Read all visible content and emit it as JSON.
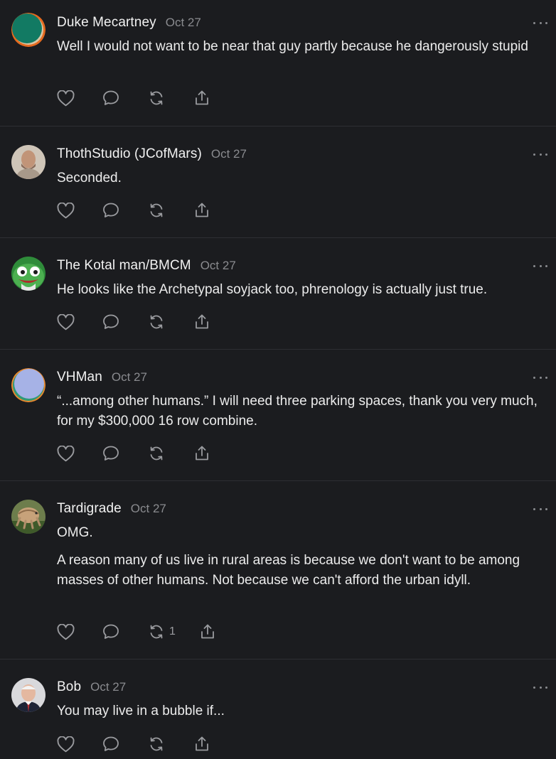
{
  "comments": [
    {
      "author": "Duke Mecartney",
      "date": "Oct 27",
      "paragraphs": [
        "Well I would not want to be near that guy partly because he dangerously stupid"
      ],
      "restack_count": ""
    },
    {
      "author": "ThothStudio (JCofMars)",
      "date": "Oct 27",
      "paragraphs": [
        "Seconded."
      ],
      "restack_count": ""
    },
    {
      "author": "The Kotal man/BMCM",
      "date": "Oct 27",
      "paragraphs": [
        "He looks like the Archetypal soyjack too, phrenology is actually just true."
      ],
      "restack_count": ""
    },
    {
      "author": "VHMan",
      "date": "Oct 27",
      "paragraphs": [
        "“...among other humans.” I will need three parking spaces, thank you very much, for my $300,000 16 row combine."
      ],
      "restack_count": ""
    },
    {
      "author": "Tardigrade",
      "date": "Oct 27",
      "paragraphs": [
        "OMG.",
        "A reason many of us live in rural areas is because we don't want to be among masses of other humans. Not because we can't afford the urban idyll."
      ],
      "restack_count": "1"
    },
    {
      "author": "Bob",
      "date": "Oct 27",
      "paragraphs": [
        "You may live in a bubble if..."
      ],
      "restack_count": ""
    }
  ],
  "icons": {
    "like": "heart-icon",
    "reply": "comment-bubble-icon",
    "restack": "restack-icon",
    "share": "share-icon",
    "more": "more-options-icon"
  },
  "colors": {
    "background": "#1b1c1f",
    "text": "#ececec",
    "muted": "#8a8b8f",
    "divider": "#2e2f33"
  }
}
